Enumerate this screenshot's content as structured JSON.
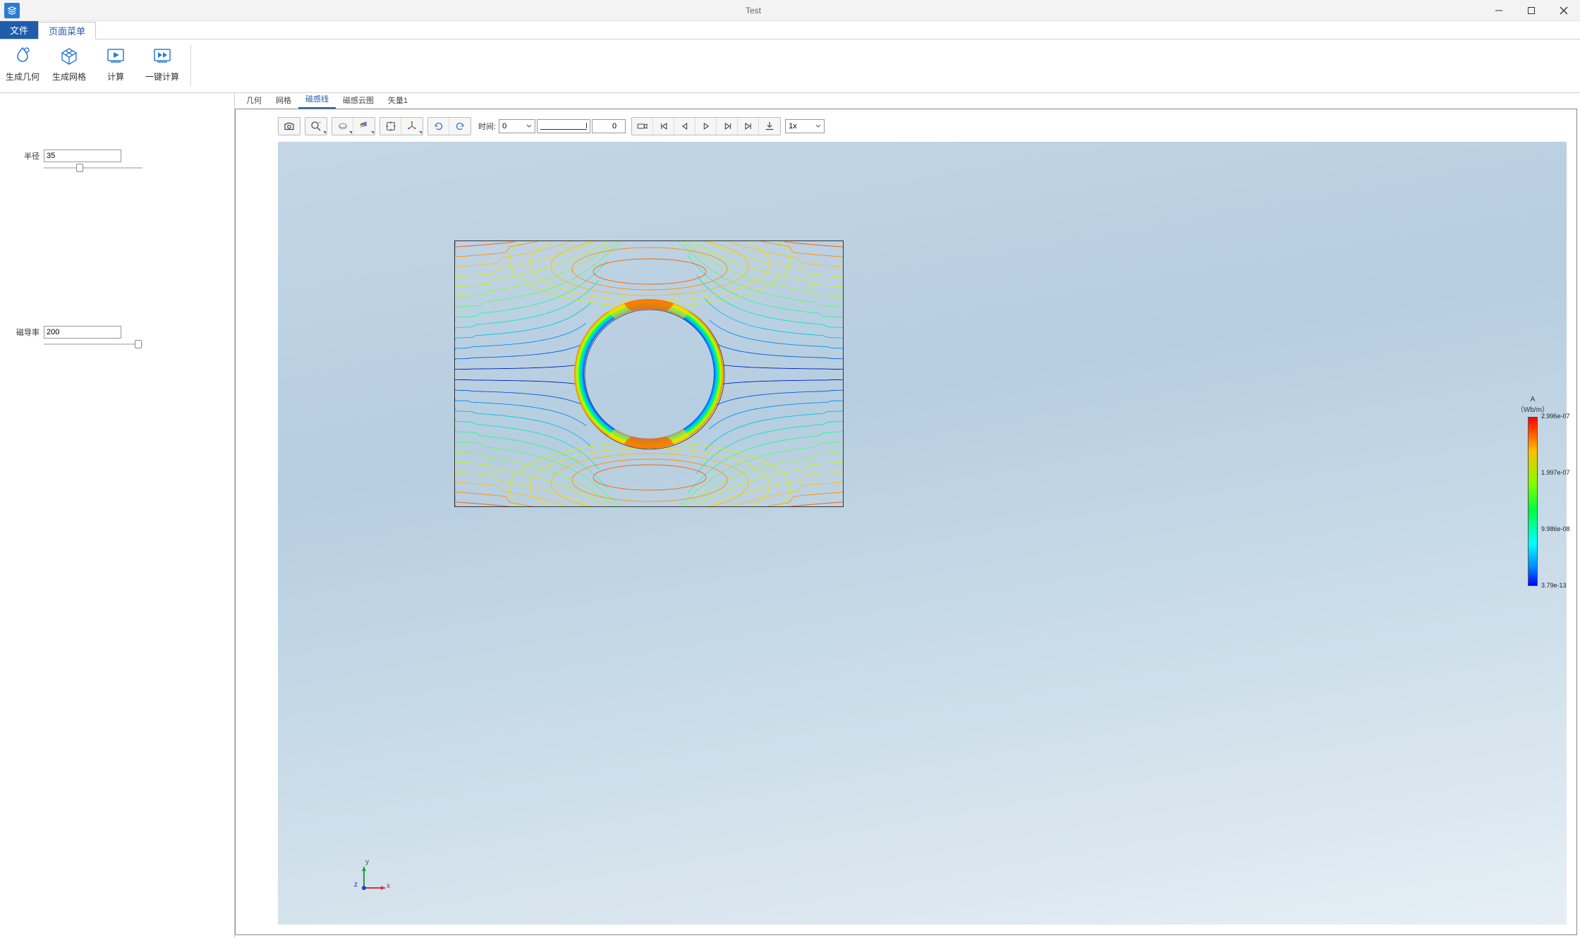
{
  "window": {
    "title": "Test"
  },
  "menus": {
    "file": "文件",
    "page": "页面菜单"
  },
  "ribbon": {
    "gen_geom": "生成几何",
    "gen_mesh": "生成网格",
    "compute": "计算",
    "one_click": "一键计算"
  },
  "sidebar": {
    "radius_label": "半径",
    "radius_value": "35",
    "radius_slider_pos": 0.35,
    "perm_label": "磁导率",
    "perm_value": "200",
    "perm_slider_pos": 0.99
  },
  "tabs": [
    "几何",
    "网格",
    "磁感线",
    "磁感云图",
    "矢量1"
  ],
  "active_tab": 2,
  "toolbar": {
    "time_label": "时间:",
    "time_value": "0",
    "frame_value": "0",
    "speed": "1x"
  },
  "legend": {
    "title1": "A",
    "title2": "（Wb/m）",
    "max": "2.996e-07",
    "t2": "1.997e-07",
    "t3": "9.986e-08",
    "min": "3.79e-13"
  },
  "axis": {
    "x": "x",
    "y": "y",
    "z": "z"
  },
  "colors": {
    "accent": "#1f5dab"
  }
}
